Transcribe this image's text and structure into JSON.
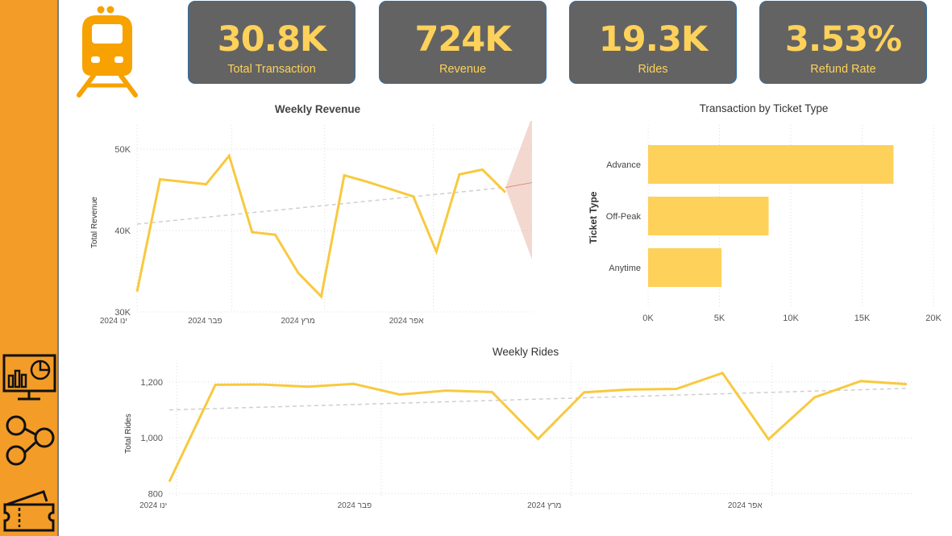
{
  "theme": {
    "sidebar": "#f39c28",
    "card": "#636363",
    "accent": "#fdd15a",
    "line": "#f8c93f",
    "forecast": "#e9b8aa",
    "trend": "#cfcfcf"
  },
  "sidebar": {
    "icons": [
      "dashboard-monitor-icon",
      "network-graph-icon",
      "ticket-icon"
    ]
  },
  "logo": {
    "icon": "train-icon"
  },
  "kpis": [
    {
      "value": "30.8K",
      "label": "Total Transaction"
    },
    {
      "value": "724K",
      "label": "Revenue"
    },
    {
      "value": "19.3K",
      "label": "Rides"
    },
    {
      "value": "3.53%",
      "label": "Refund Rate"
    }
  ],
  "chart_data": [
    {
      "id": "weekly-revenue",
      "type": "line",
      "title": "Weekly Revenue",
      "xlabel": "",
      "ylabel": "Total Revenue",
      "x_ticks": [
        "ינו 2024",
        "פבר 2024",
        "מרץ 2024",
        "אפר 2024"
      ],
      "y_ticks": [
        "30K",
        "40K",
        "50K"
      ],
      "ylim": [
        30000,
        52000
      ],
      "series": [
        {
          "values": [
            32500,
            46300,
            46000,
            45700,
            49200,
            39800,
            39500,
            34800,
            31900,
            46800,
            46000,
            45100,
            44200,
            37400,
            46900,
            47500,
            44700
          ]
        }
      ],
      "trend": {
        "start": 40800,
        "end": 45300
      },
      "forecast": {
        "value": 45300,
        "upper": 54000,
        "lower": 36400
      },
      "grid": true
    },
    {
      "id": "ticket-type",
      "type": "bar",
      "orientation": "horizontal",
      "title": "Transaction by Ticket Type",
      "ylabel": "Ticket Type",
      "categories": [
        "Advance",
        "Off-Peak",
        "Anytime"
      ],
      "values": [
        17200,
        8450,
        5150
      ],
      "x_ticks": [
        "0K",
        "5K",
        "10K",
        "15K",
        "20K"
      ],
      "xlim": [
        0,
        20000
      ],
      "grid": true
    },
    {
      "id": "weekly-rides",
      "type": "line",
      "title": "Weekly Rides",
      "xlabel": "",
      "ylabel": "Total Rides",
      "x_ticks": [
        "ינו 2024",
        "פבר 2024",
        "מרץ 2024",
        "אפר 2024"
      ],
      "y_ticks": [
        "800",
        "1,000",
        "1,200"
      ],
      "ylim": [
        790,
        1240
      ],
      "series": [
        {
          "values": [
            843,
            1190,
            1191,
            1183,
            1193,
            1155,
            1169,
            1164,
            996,
            1163,
            1173,
            1175,
            1232,
            995,
            1145,
            1203,
            1192
          ]
        }
      ],
      "trend": {
        "start": 1100,
        "end": 1177
      },
      "grid": true
    }
  ]
}
